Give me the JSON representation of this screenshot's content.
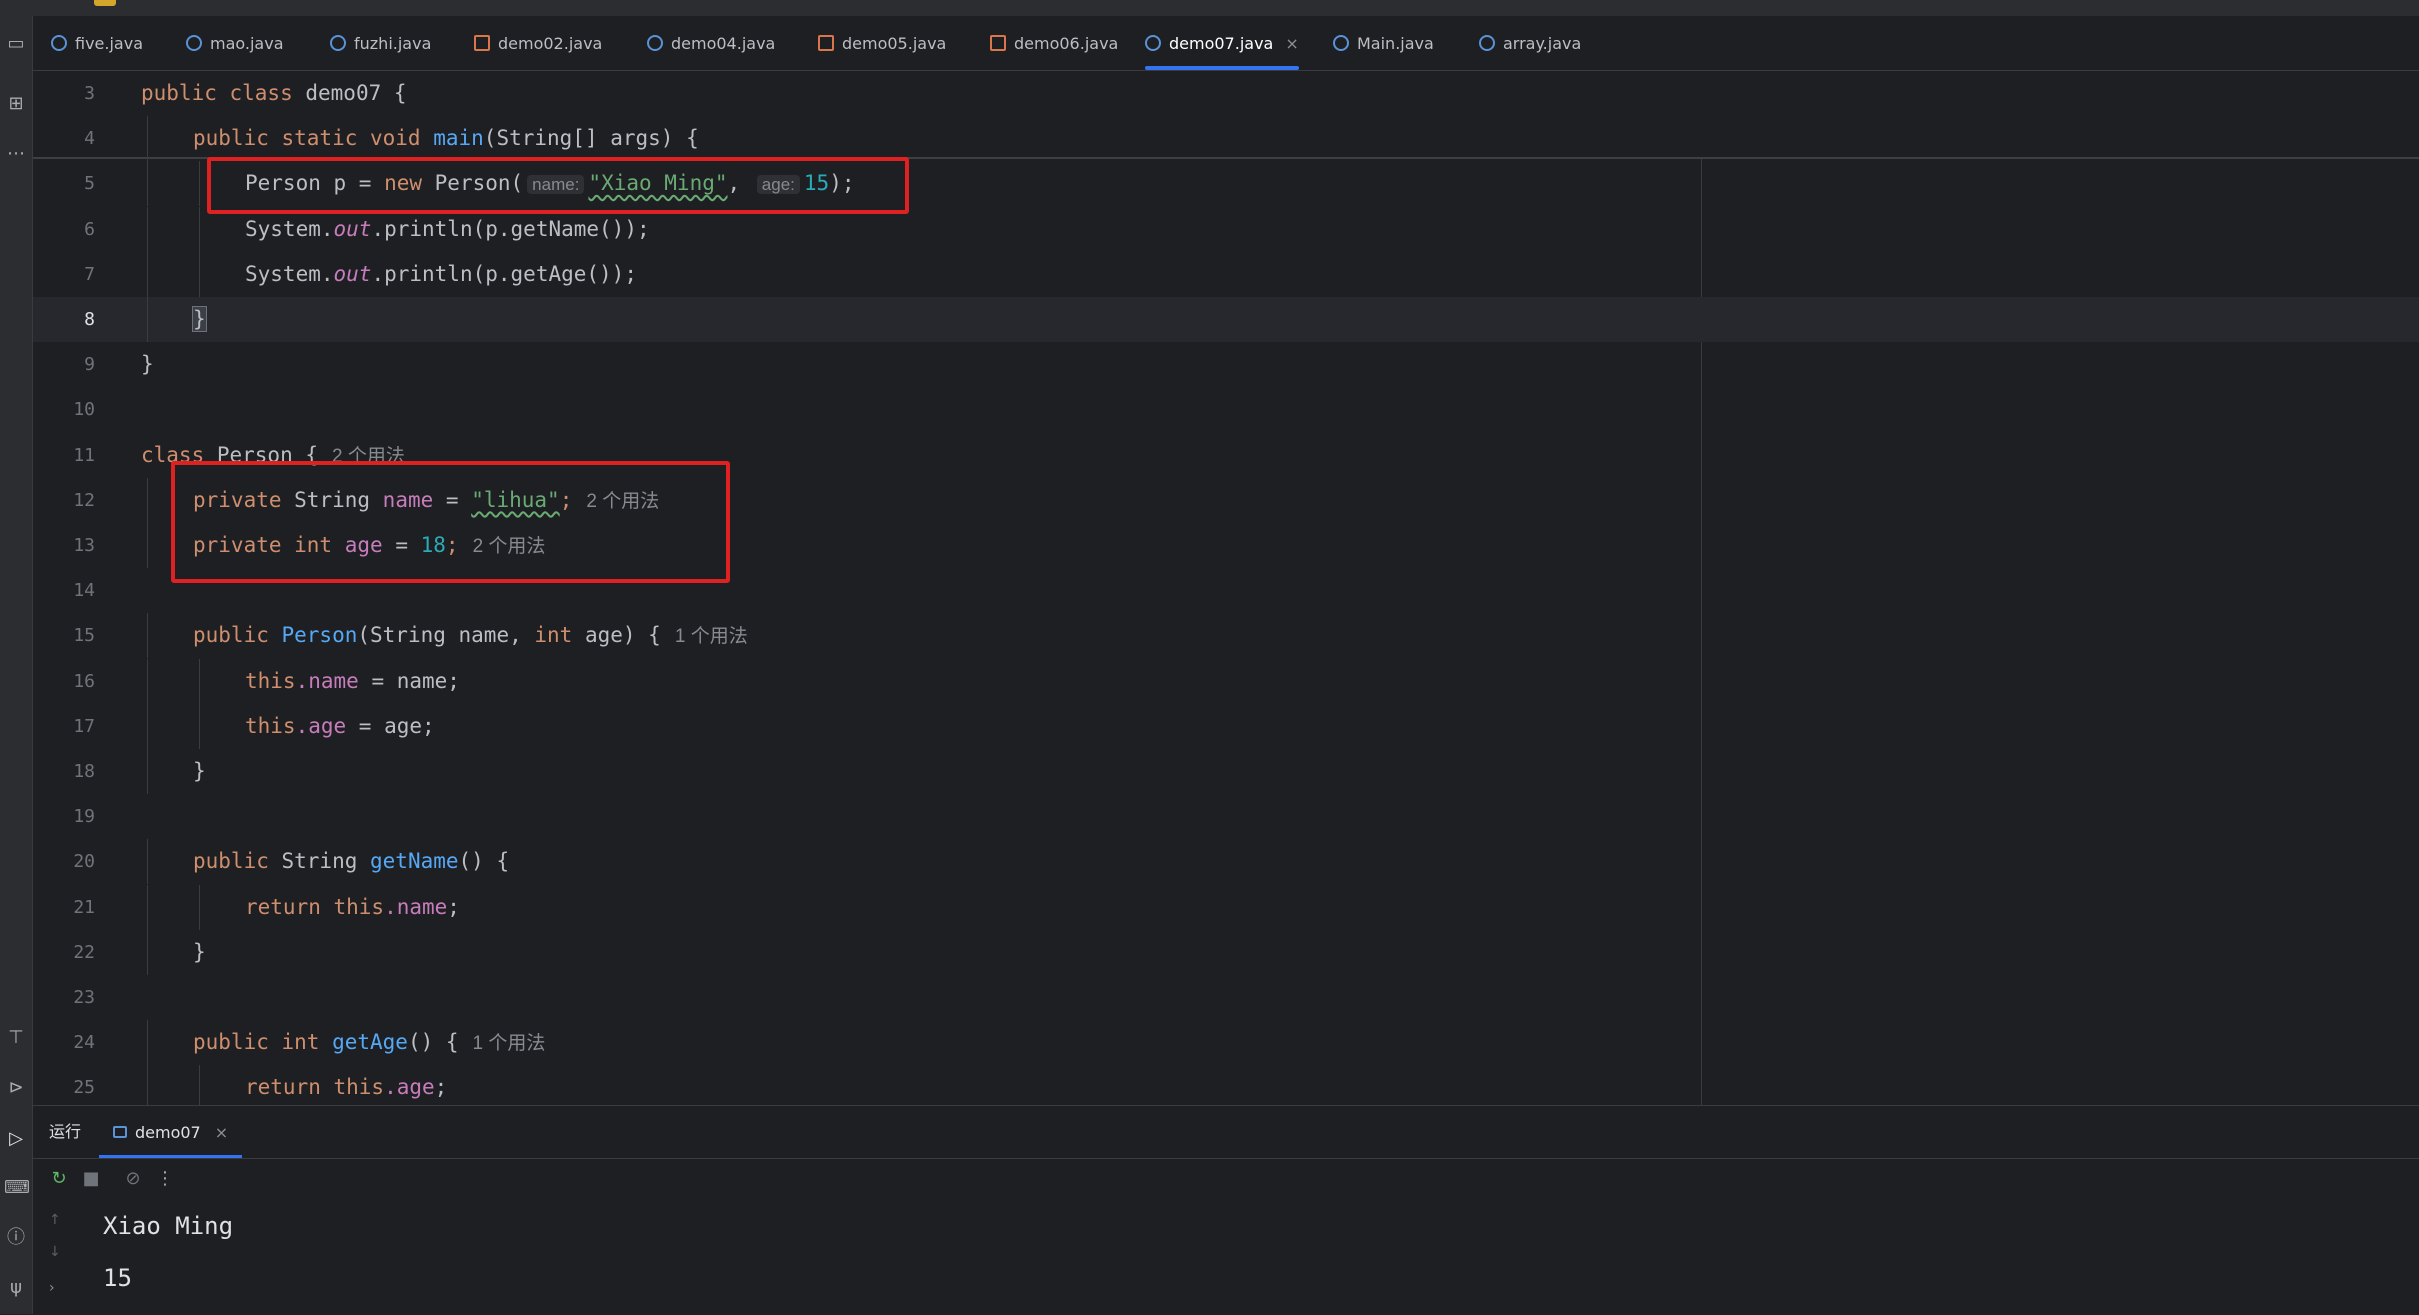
{
  "tabs": [
    {
      "label": "five.java",
      "icon": "class-icon",
      "active": false
    },
    {
      "label": "mao.java",
      "icon": "class-icon",
      "active": false
    },
    {
      "label": "fuzhi.java",
      "icon": "class-icon",
      "active": false
    },
    {
      "label": "demo02.java",
      "icon": "java-file-icon",
      "active": false
    },
    {
      "label": "demo04.java",
      "icon": "class-icon",
      "active": false
    },
    {
      "label": "demo05.java",
      "icon": "java-file-icon",
      "active": false
    },
    {
      "label": "demo06.java",
      "icon": "java-file-icon",
      "active": false
    },
    {
      "label": "demo07.java",
      "icon": "class-icon",
      "active": true,
      "close": "×"
    },
    {
      "label": "Main.java",
      "icon": "class-icon",
      "active": false
    },
    {
      "label": "array.java",
      "icon": "class-icon",
      "active": false
    }
  ],
  "inspections": {
    "warning_count": "2"
  },
  "editor": {
    "lines": [
      {
        "n": "3",
        "a": "public class ",
        "b": "demo07",
        "c": " {"
      },
      {
        "n": "4",
        "a": "public static void ",
        "fn": "main",
        "rest": "(String[] args) {"
      },
      {
        "n": "5",
        "pre": "Person p = ",
        "kw": "new",
        "post": " Person(",
        "p1": "name:",
        "s1": "\"Xiao Ming\"",
        "comma": ", ",
        "p2": "age:",
        "num": "15",
        "end": ");"
      },
      {
        "n": "6",
        "a": "System.",
        "out": "out",
        "b": ".println(p.getName());"
      },
      {
        "n": "7",
        "a": "System.",
        "out": "out",
        "b": ".println(p.getAge());"
      },
      {
        "n": "8",
        "brace": "}"
      },
      {
        "n": "9",
        "brace": "}"
      },
      {
        "n": "10"
      },
      {
        "n": "11",
        "kw": "class",
        "b": " Person {",
        "hint": "2 个用法"
      },
      {
        "n": "12",
        "kw": "private",
        "t": " String ",
        "f": "name",
        "eq": " = ",
        "s": "\"lihua\"",
        "semi": ";",
        "hint": "2 个用法"
      },
      {
        "n": "13",
        "kw": "private int",
        "t": " ",
        "f": "age",
        "eq": " = ",
        "num": "18",
        "semi": ";",
        "hint": "2 个用法"
      },
      {
        "n": "14"
      },
      {
        "n": "15",
        "kw": "public",
        "fn": " Person",
        "a": "(String name, ",
        "kw2": "int",
        "b": " age) {",
        "hint": "1 个用法"
      },
      {
        "n": "16",
        "kw": "this",
        "f": ".name",
        "b": " = name;"
      },
      {
        "n": "17",
        "kw": "this",
        "f": ".age",
        "b": " = age;"
      },
      {
        "n": "18",
        "brace": "}"
      },
      {
        "n": "19"
      },
      {
        "n": "20",
        "kw": "public",
        "t": " String ",
        "fn": "getName",
        "b": "() {"
      },
      {
        "n": "21",
        "kw": "return this",
        "f": ".name",
        "b": ";"
      },
      {
        "n": "22",
        "brace": "}"
      },
      {
        "n": "23"
      },
      {
        "n": "24",
        "kw": "public int",
        "fn": " getAge",
        "b": "() {",
        "hint": "1 个用法"
      },
      {
        "n": "25",
        "kw": "return this",
        "f": ".age",
        "b": ";"
      }
    ]
  },
  "run": {
    "label": "运行",
    "tab": "demo07",
    "tab_close": "×",
    "output": [
      "Xiao Ming",
      "15"
    ]
  }
}
